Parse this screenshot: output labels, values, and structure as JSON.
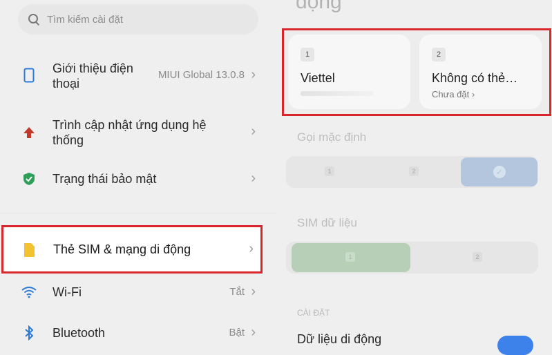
{
  "search": {
    "placeholder": "Tìm kiếm cài đặt"
  },
  "settings_list": [
    {
      "label": "Giới thiệu điện\nthoại",
      "value": "MIUI Global 13.0.8",
      "icon": "phone-icon"
    },
    {
      "label": "Trình cập nhật ứng dụng hệ\nthống",
      "value": "",
      "icon": "arrow-up-icon"
    },
    {
      "label": "Trạng thái bảo mật",
      "value": "",
      "icon": "shield-icon"
    },
    {
      "label": "Thẻ SIM & mạng di động",
      "value": "",
      "icon": "sim-icon"
    },
    {
      "label": "Wi-Fi",
      "value": "Tắt",
      "icon": "wifi-icon"
    },
    {
      "label": "Bluetooth",
      "value": "Bật",
      "icon": "bluetooth-icon"
    }
  ],
  "sim_page": {
    "title_partial": "động",
    "sim1": {
      "slot": "1",
      "name": "Viettel"
    },
    "sim2": {
      "slot": "2",
      "name": "Không có thẻ…",
      "status": "Chưa đặt"
    },
    "default_calls_label": "Gọi mặc định",
    "sim_data_label": "SIM dữ liệu",
    "seg_slot1": "1",
    "seg_slot2": "2",
    "settings_section": "CÀI ĐẶT",
    "mobile_data_label": "Dữ liệu di động",
    "mobile_data_on": true
  },
  "colors": {
    "highlight": "#d8262c",
    "toggle_on": "#3d82ea",
    "shield": "#2e9e59",
    "arrow": "#c0392b",
    "sim": "#f2c230",
    "phone": "#2d7bd8"
  }
}
